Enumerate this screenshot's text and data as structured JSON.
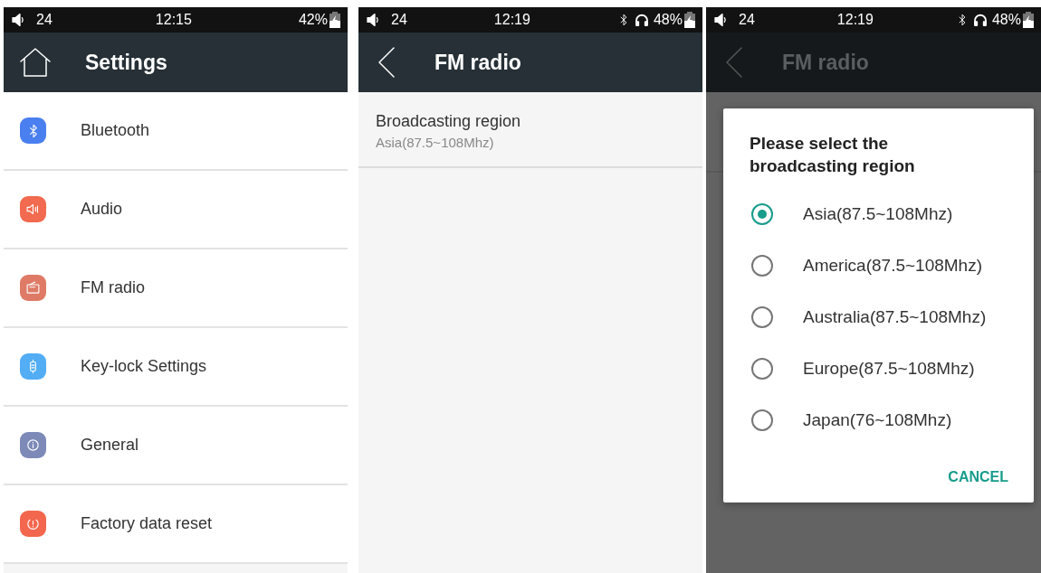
{
  "screens": [
    {
      "status": {
        "volume": "24",
        "time": "12:15",
        "bluetooth": false,
        "headphones": false,
        "battery": "42%"
      },
      "header": {
        "kind": "home",
        "title": "Settings"
      },
      "dimmed": false,
      "items": [
        {
          "label": "Bluetooth",
          "kind": "bluetooth",
          "color": "#4a7ff0"
        },
        {
          "label": "Audio",
          "kind": "speaker",
          "color": "#f26a4f"
        },
        {
          "label": "FM radio",
          "kind": "radio",
          "color": "#de7a66"
        },
        {
          "label": "Key-lock Settings",
          "kind": "keylock",
          "color": "#52adf5"
        },
        {
          "label": "General",
          "kind": "info",
          "color": "#7d8ab8"
        },
        {
          "label": "Factory data reset",
          "kind": "reset",
          "color": "#f2674e"
        }
      ]
    },
    {
      "status": {
        "volume": "24",
        "time": "12:19",
        "bluetooth": true,
        "headphones": true,
        "battery": "48%"
      },
      "header": {
        "kind": "back",
        "title": "FM radio"
      },
      "dimmed": false,
      "items": [
        {
          "label": "Broadcasting region",
          "value": "Asia(87.5~108Mhz)"
        }
      ]
    },
    {
      "status": {
        "volume": "24",
        "time": "12:19",
        "bluetooth": true,
        "headphones": true,
        "battery": "48%"
      },
      "header": {
        "kind": "back",
        "title": "FM radio"
      },
      "dimmed": true,
      "dialog": {
        "title": "Please select the broadcasting region",
        "options": [
          {
            "label": "Asia(87.5~108Mhz)",
            "selected": true
          },
          {
            "label": "America(87.5~108Mhz)",
            "selected": false
          },
          {
            "label": "Australia(87.5~108Mhz)",
            "selected": false
          },
          {
            "label": "Europe(87.5~108Mhz)",
            "selected": false
          },
          {
            "label": "Japan(76~108Mhz)",
            "selected": false
          }
        ],
        "button": "CANCEL"
      }
    }
  ]
}
